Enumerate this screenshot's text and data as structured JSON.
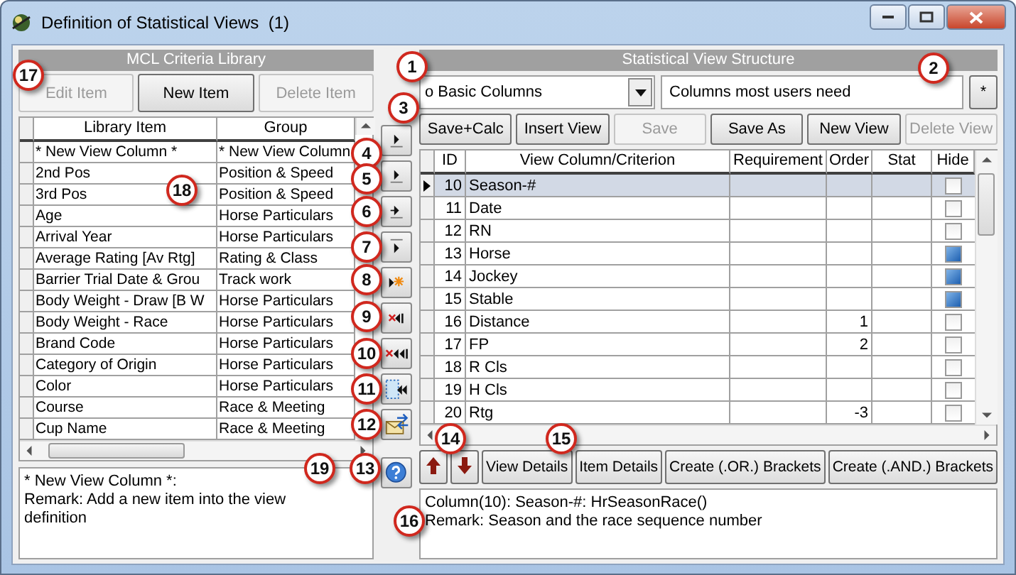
{
  "window": {
    "title": "Definition of Statistical Views  (1)"
  },
  "library": {
    "title": "MCL Criteria Library",
    "buttons": [
      {
        "label": "Edit Item",
        "disabled": true
      },
      {
        "label": "New Item",
        "disabled": false
      },
      {
        "label": "Delete Item",
        "disabled": true
      }
    ],
    "columns": [
      "Library Item",
      "Group"
    ],
    "rows": [
      {
        "item": "* New View Column *",
        "group": "* New View Column"
      },
      {
        "item": "2nd Pos",
        "group": "Position & Speed"
      },
      {
        "item": "3rd Pos",
        "group": "Position & Speed"
      },
      {
        "item": "Age",
        "group": "Horse Particulars"
      },
      {
        "item": "Arrival Year",
        "group": "Horse Particulars"
      },
      {
        "item": "Average Rating [Av Rtg]",
        "group": "Rating & Class"
      },
      {
        "item": "Barrier Trial Date & Grou",
        "group": "Track work"
      },
      {
        "item": "Body Weight - Draw [B W",
        "group": "Horse Particulars"
      },
      {
        "item": "Body Weight - Race",
        "group": "Horse Particulars"
      },
      {
        "item": "Brand Code",
        "group": "Horse Particulars"
      },
      {
        "item": "Category of Origin",
        "group": "Horse Particulars"
      },
      {
        "item": "Color",
        "group": "Horse Particulars"
      },
      {
        "item": "Course",
        "group": "Race & Meeting"
      },
      {
        "item": "Cup Name",
        "group": "Race & Meeting"
      }
    ],
    "remark": "* New View Column *:\nRemark: Add a new item into the view definition"
  },
  "transfer_buttons": [
    {
      "kind": "add-under"
    },
    {
      "kind": "add-under"
    },
    {
      "kind": "arrow-under"
    },
    {
      "kind": "add-over"
    },
    {
      "kind": "add-star"
    },
    {
      "kind": "remove-one"
    },
    {
      "kind": "remove-all"
    },
    {
      "kind": "clear-box"
    },
    {
      "kind": "mail"
    },
    {
      "kind": "help"
    }
  ],
  "view": {
    "title": "Statistical View Structure",
    "view_select": "o Basic Columns",
    "description": "Columns most users need",
    "asterisk_button": "*",
    "buttons": [
      {
        "label": "Save+Calc",
        "disabled": false
      },
      {
        "label": "Insert View",
        "disabled": false
      },
      {
        "label": "Save",
        "disabled": true
      },
      {
        "label": "Save As",
        "disabled": false
      },
      {
        "label": "New View",
        "disabled": false
      },
      {
        "label": "Delete View",
        "disabled": true
      }
    ],
    "columns": [
      "ID",
      "View Column/Criterion",
      "Requirement",
      "Order",
      "Stat",
      "Hide"
    ],
    "rows": [
      {
        "id": "10",
        "name": "Season-#",
        "hide": false,
        "selected": true
      },
      {
        "id": "11",
        "name": "Date",
        "hide": false,
        "selected": false
      },
      {
        "id": "12",
        "name": "RN",
        "hide": false,
        "selected": false
      },
      {
        "id": "13",
        "name": "Horse",
        "hide": true,
        "selected": false
      },
      {
        "id": "14",
        "name": "Jockey",
        "hide": true,
        "selected": false
      },
      {
        "id": "15",
        "name": "Stable",
        "hide": true,
        "selected": false
      },
      {
        "id": "16",
        "name": "Distance",
        "order": "1",
        "hide": false,
        "selected": false
      },
      {
        "id": "17",
        "name": "FP",
        "order": "2",
        "hide": false,
        "selected": false
      },
      {
        "id": "18",
        "name": "R Cls",
        "hide": false,
        "selected": false
      },
      {
        "id": "19",
        "name": "H Cls",
        "hide": false,
        "selected": false
      },
      {
        "id": "20",
        "name": "Rtg",
        "order": "-3",
        "hide": false,
        "selected": false
      }
    ],
    "bottom_buttons": [
      {
        "kind": "up"
      },
      {
        "kind": "down"
      },
      {
        "kind": "text",
        "label": "View Details"
      },
      {
        "kind": "text",
        "label": "Item Details"
      },
      {
        "kind": "text",
        "label": "Create (.OR.) Brackets"
      },
      {
        "kind": "text",
        "label": "Create (.AND.) Brackets"
      }
    ],
    "remark": "Column(10): Season-#: HrSeasonRace()\nRemark: Season and the race sequence number"
  },
  "callouts": [
    "1",
    "2",
    "3",
    "4",
    "5",
    "6",
    "7",
    "8",
    "9",
    "10",
    "11",
    "12",
    "13",
    "14",
    "15",
    "16",
    "17",
    "18",
    "19"
  ]
}
